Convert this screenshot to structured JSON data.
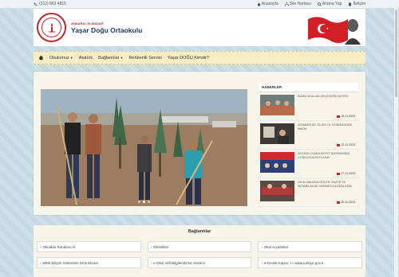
{
  "topbar": {
    "phone": "(312) 863 4815",
    "links": [
      {
        "icon": "home-icon",
        "label": "Anasayfa"
      },
      {
        "icon": "sitemap-icon",
        "label": "Site Haritası"
      },
      {
        "icon": "search-icon",
        "label": "Arama Yap"
      },
      {
        "icon": "document-icon",
        "label": "İletişim"
      }
    ]
  },
  "header": {
    "school_location": "ANKARA / ELMADAĞ",
    "school_name": "Yaşar Doğu Ortaokulu"
  },
  "nav": {
    "home_icon": "home-icon",
    "items": [
      {
        "label": "Okulumuz",
        "dropdown": true
      },
      {
        "label": "Atatürk",
        "dropdown": false
      },
      {
        "label": "Bağlantılar",
        "dropdown": true
      },
      {
        "label": "Rehberlik Servisi",
        "dropdown": false
      },
      {
        "label": "Yaşar DOĞU Kimdir?",
        "dropdown": false
      }
    ]
  },
  "news": {
    "title": "HABERLER",
    "items": [
      {
        "text": "BİZİM OKULUM GELECEĞE NOTES",
        "date": "15-11-2023"
      },
      {
        "text": "ATAMIZIN 85. ÖLÜM YIL DÖNÜMÜNDE ANDIK",
        "date": "10-11-2023"
      },
      {
        "text": "29 EKİM CUMHURİYET BAYRAMIMIZ COŞKUYLA KUTLADIK",
        "date": "07-11-2023"
      },
      {
        "text": "OKULUMUZDA GÜLER GAZZE'YE AKTARILACAK KERMES DÜZENLEDİK",
        "date": "26-10-2023"
      }
    ]
  },
  "links": {
    "title": "Bağlantılar",
    "items": [
      "Okuldan Randevu Al",
      "Etkinlikler",
      "Okul Kıyafetleri",
      "MEB Bilişim Sistemleri Giriş Ekranı",
      "e-Okul Veli Bilgilendirme Sistemi",
      "e-Devlet Kapısı >> www.turkiye.gov.tr"
    ]
  },
  "colors": {
    "accent": "#c0272d",
    "brand_blue": "#1c3b6b",
    "nav_bg": "#f7edc4"
  }
}
